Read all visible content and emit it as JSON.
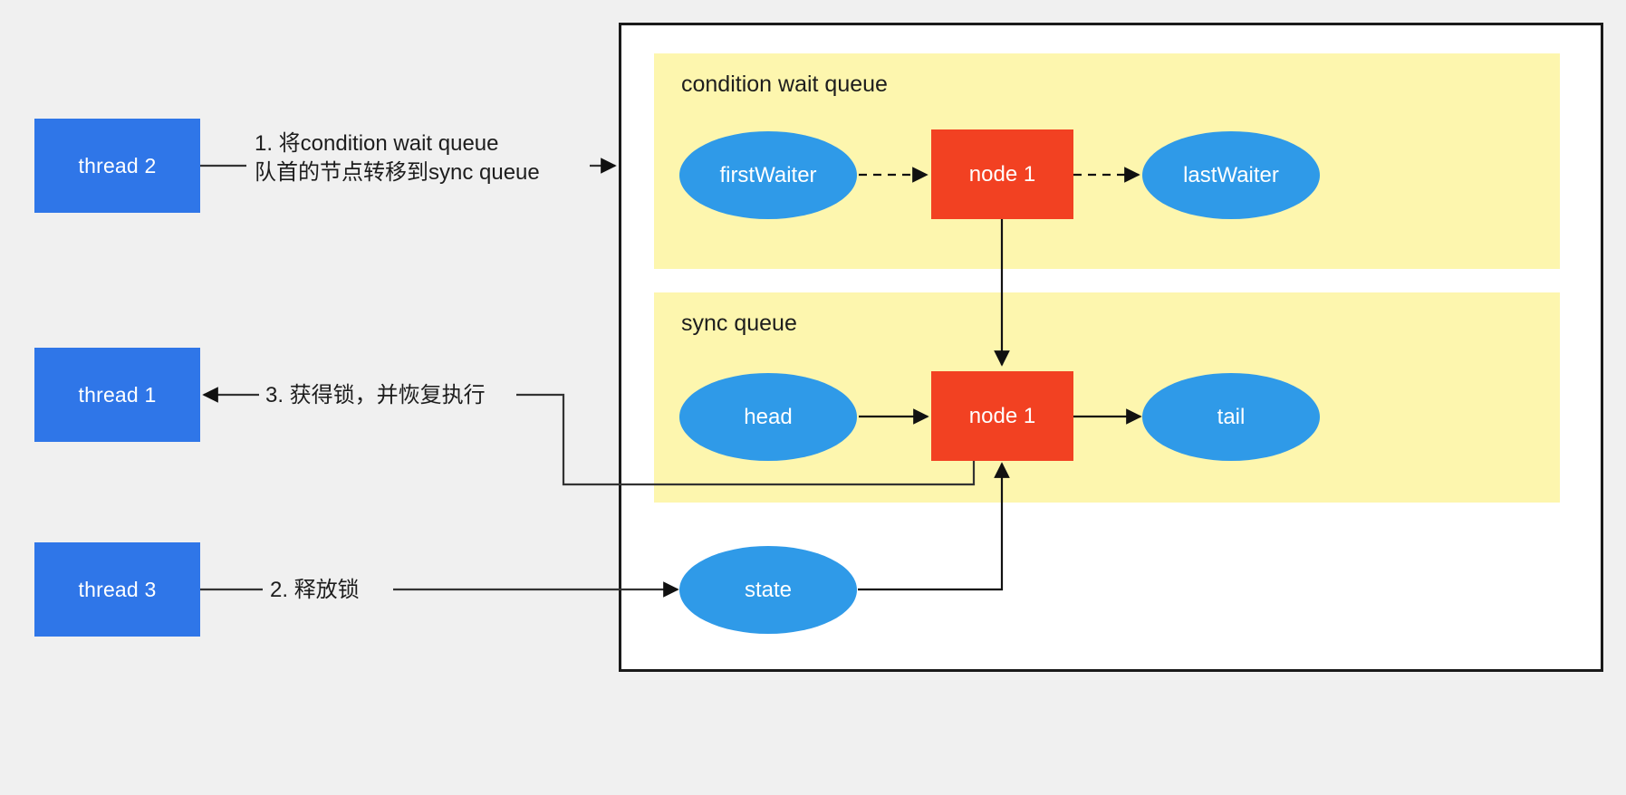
{
  "diagram": {
    "title": "AQS condition wait queue to sync queue transfer",
    "background_color": "#f0f0f0",
    "container_border_color": "#1a1a1a",
    "band_color": "#fdf6ae",
    "ellipse_color": "#2f9ae8",
    "rect_color": "#f24122",
    "thread_color": "#2f76e8"
  },
  "threads": [
    {
      "label": "thread 2"
    },
    {
      "label": "thread 1"
    },
    {
      "label": "thread 3"
    }
  ],
  "edge_labels": {
    "step1_line1": "1. 将condition wait queue",
    "step1_line2": "队首的节点转移到sync queue",
    "step3": "3. 获得锁，并恢复执行",
    "step2": "2. 释放锁"
  },
  "condition_queue": {
    "title": "condition wait queue",
    "nodes": [
      {
        "label": "firstWaiter",
        "shape": "ellipse"
      },
      {
        "label": "node 1",
        "shape": "rect"
      },
      {
        "label": "lastWaiter",
        "shape": "ellipse"
      }
    ]
  },
  "sync_queue": {
    "title": "sync queue",
    "nodes": [
      {
        "label": "head",
        "shape": "ellipse"
      },
      {
        "label": "node 1",
        "shape": "rect"
      },
      {
        "label": "tail",
        "shape": "ellipse"
      }
    ]
  },
  "state_node": {
    "label": "state",
    "shape": "ellipse"
  }
}
